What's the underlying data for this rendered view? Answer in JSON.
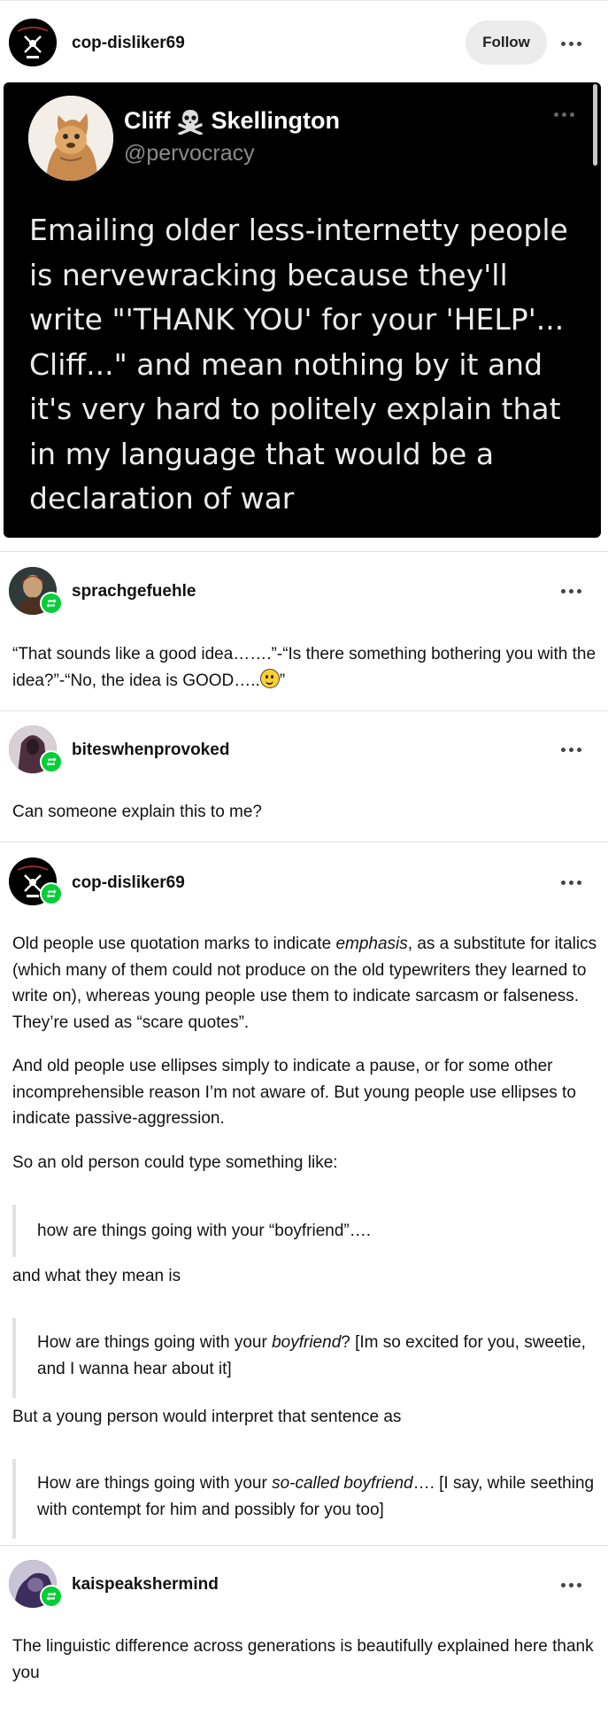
{
  "post": {
    "username": "cop-disliker69",
    "follow_label": "Follow"
  },
  "tweet": {
    "display_name": "Cliff",
    "display_name_suffix": "Skellington",
    "handle": "@pervocracy",
    "text": "Emailing older less-internetty people is nervewracking because they'll write \"'THANK YOU' for your 'HELP'... Cliff...\" and mean nothing by it and it's very hard to politely explain that in my language that would be a declaration of war"
  },
  "reblogs": [
    {
      "username": "sprachgefuehle",
      "text_before_emoji": "“That sounds like a good idea…….”-“Is there something bothering you with the idea?”-“No, the idea is GOOD…..",
      "text_after_emoji": "”"
    },
    {
      "username": "biteswhenprovoked",
      "text": "Can someone explain this to me?"
    },
    {
      "username": "cop-disliker69",
      "p1_a": "Old people use quotation marks to indicate ",
      "p1_em": "emphasis",
      "p1_b": ", as a substitute for italics (which many of them could not produce on the old typewriters they learned to write on), whereas young people use them to indicate sarcasm or falseness. They’re used as “scare quotes”.",
      "p2": "And old people use ellipses simply to indicate a pause, or for some other incomprehensible reason I’m not aware of. But young people use ellipses to indicate passive-aggression.",
      "p3": "So an old person could type something like:",
      "q1": "how are things going with your “boyfriend”….",
      "p4": "and what they mean is",
      "q2_a": "How are things going with your ",
      "q2_em": "boyfriend",
      "q2_b": "? [Im so excited for you, sweetie, and I wanna hear about it]",
      "p5": "But a young person would interpret that sentence as",
      "q3_a": "How are things going with your ",
      "q3_em": "so-called boyfriend",
      "q3_b": "…. [I say, while seething with contempt for him and possibly for you too]"
    },
    {
      "username": "kaispeakshermind",
      "text": "The linguistic difference across generations is beautifully explained here thank you"
    }
  ],
  "colors": {
    "reblog_badge": "#00cf35",
    "tweet_background": "#000000"
  },
  "icons": {
    "tweet_name_icon": "skull-crossbones-icon",
    "more": "more-options-icon",
    "reblog": "reblog-icon"
  }
}
